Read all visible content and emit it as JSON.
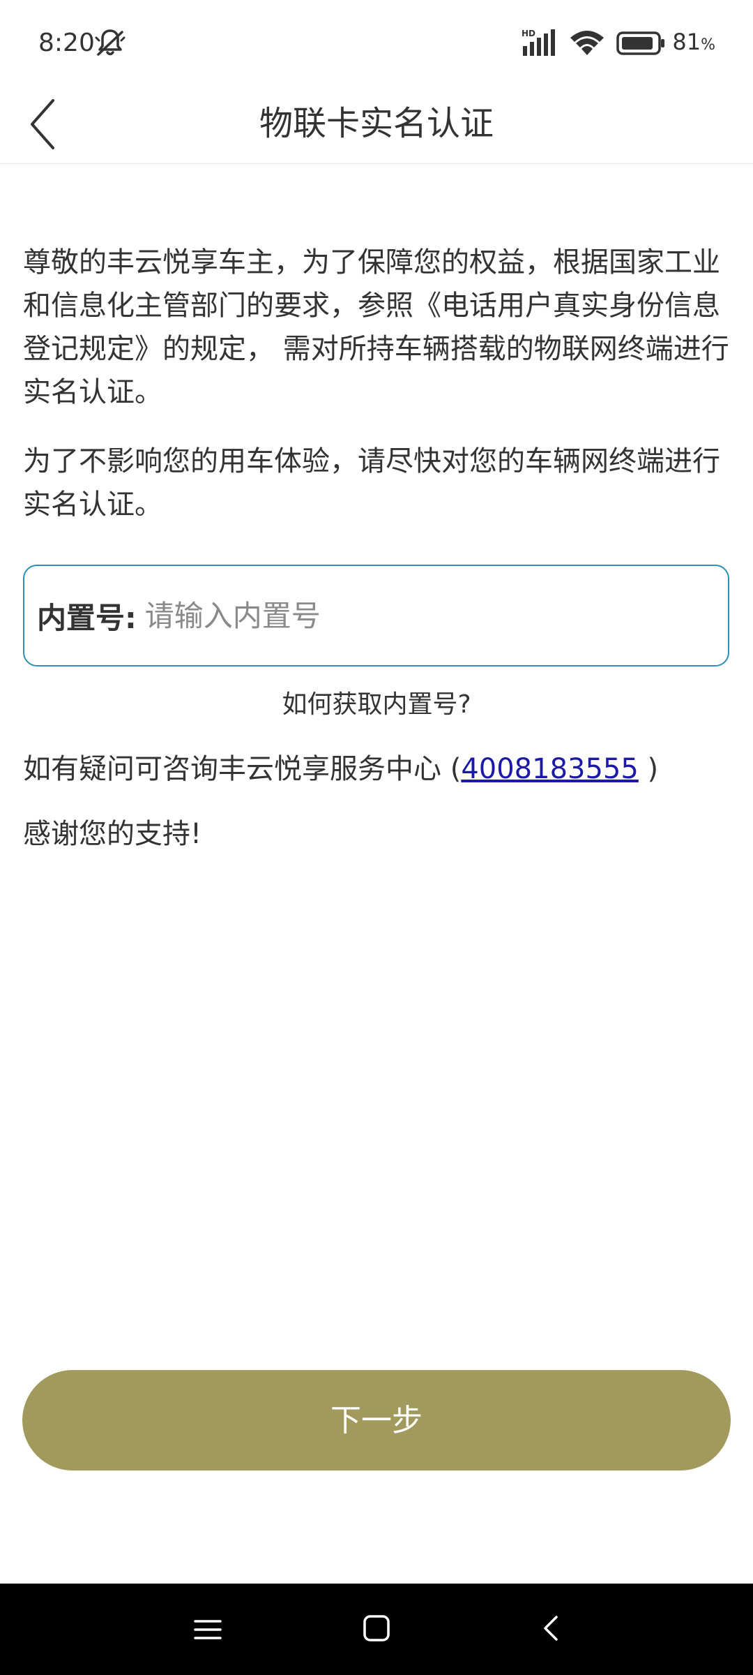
{
  "status_bar": {
    "time": "8:20",
    "battery": "81",
    "battery_unit": "%",
    "network_badge": "HD"
  },
  "header": {
    "title": "物联卡实名认证"
  },
  "content": {
    "paragraph1": "尊敬的丰云悦享车主，为了保障您的权益，根据国家工业和信息化主管部门的要求，参照《电话用户真实身份信息登记规定》的规定， 需对所持车辆搭载的物联网终端进行实名认证。",
    "paragraph2": "为了不影响您的用车体验，请尽快对您的车辆网终端进行实名认证。"
  },
  "form": {
    "label": "内置号:",
    "placeholder": "请输入内置号",
    "value": ""
  },
  "help_link": "如何获取内置号?",
  "contact": {
    "prefix": "如有疑问可咨询丰云悦享服务中心 (",
    "phone": "4008183555",
    "suffix": " )"
  },
  "thanks": "感谢您的支持!",
  "next_button": "下一步",
  "colors": {
    "accent": "#a29a5c",
    "input_border": "#2a8fb5",
    "link": "#1a1aa6"
  }
}
